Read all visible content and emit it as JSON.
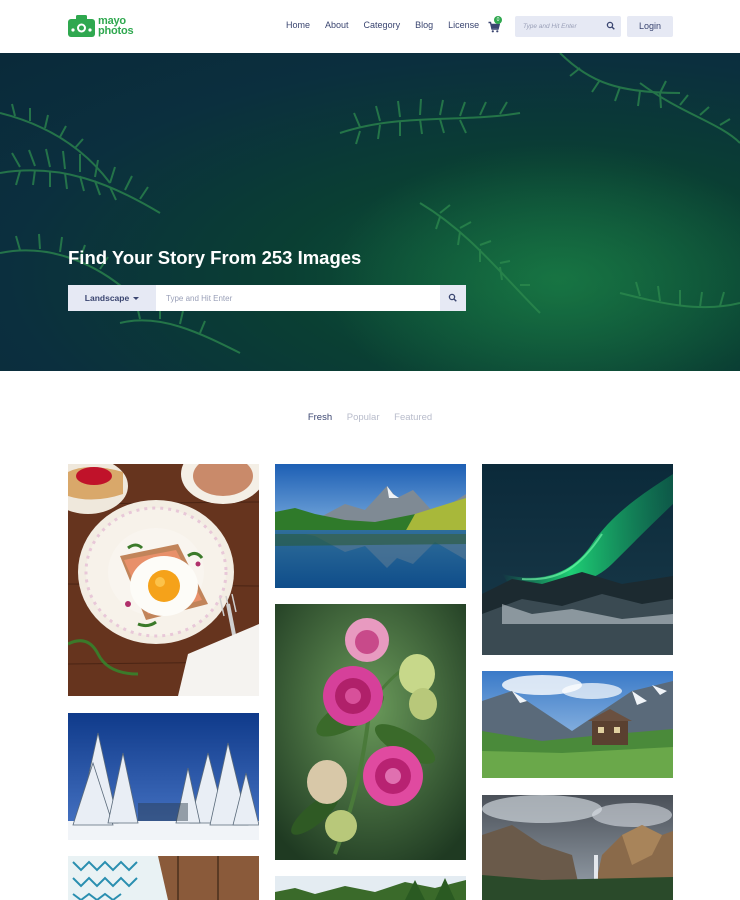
{
  "brand": {
    "name_line1": "mayo",
    "name_line2": "photos",
    "color": "#2fa84f"
  },
  "nav": {
    "items": [
      "Home",
      "About",
      "Category",
      "Blog",
      "License"
    ]
  },
  "cart": {
    "icon": "cart-icon",
    "count": "0"
  },
  "header_search": {
    "placeholder": "Type and Hit Enter",
    "icon": "search-icon"
  },
  "login": {
    "label": "Login"
  },
  "hero": {
    "title": "Find Your Story From 253 Images",
    "category": "Landscape",
    "search_placeholder": "Type and Hit Enter",
    "search_icon": "search-icon"
  },
  "tabs": [
    {
      "label": "Fresh",
      "active": true
    },
    {
      "label": "Popular",
      "active": false
    },
    {
      "label": "Featured",
      "active": false
    }
  ],
  "gallery": {
    "photos": [
      "breakfast-egg-toast",
      "mountain-lake-reflection",
      "northern-lights",
      "pink-roses-bouquet",
      "snowy-pine-forest",
      "mountain-cabin-meadow",
      "waterfall-cliffs",
      "knitted-fabric-on-wood",
      "forest-treeline"
    ]
  },
  "colors": {
    "accent": "#2fa84f",
    "nav_text": "#3a4570",
    "button_bg": "#e6e9f4",
    "muted_tab": "#b8bccb"
  }
}
